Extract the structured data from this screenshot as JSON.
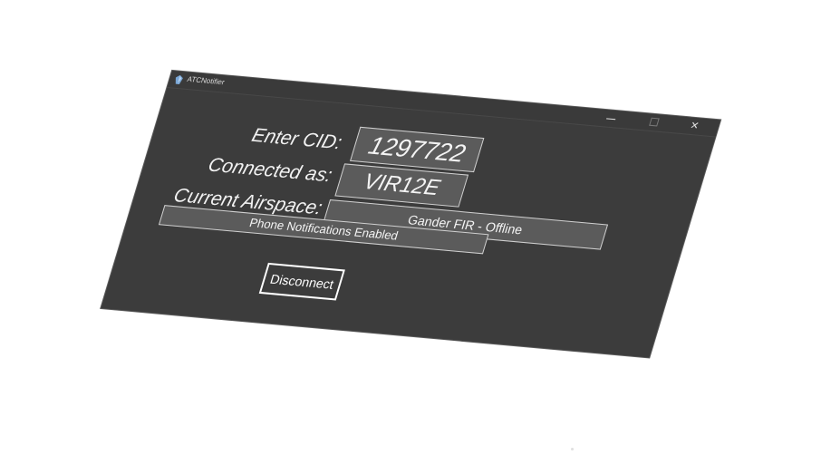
{
  "window": {
    "title": "ATCNotifier",
    "minimize_glyph": "",
    "maximize_glyph": "",
    "close_glyph": "✕"
  },
  "form": {
    "cid_label": "Enter CID:",
    "cid_value": "1297722",
    "connected_label": "Connected as:",
    "connected_value": "VIR12E",
    "airspace_label": "Current Airspace:",
    "airspace_value": "Gander FIR - Offline",
    "phone_status": "Phone Notifications Enabled",
    "disconnect_label": "Disconnect"
  },
  "icons": {
    "app": "app-icon",
    "minimize": "minimize-icon",
    "maximize": "maximize-icon",
    "close": "close-icon"
  },
  "colors": {
    "window_bg": "#3c3c3c",
    "field_bg": "#5b5b5b",
    "text": "#f2f2f2",
    "border": "#d0d0d0"
  }
}
